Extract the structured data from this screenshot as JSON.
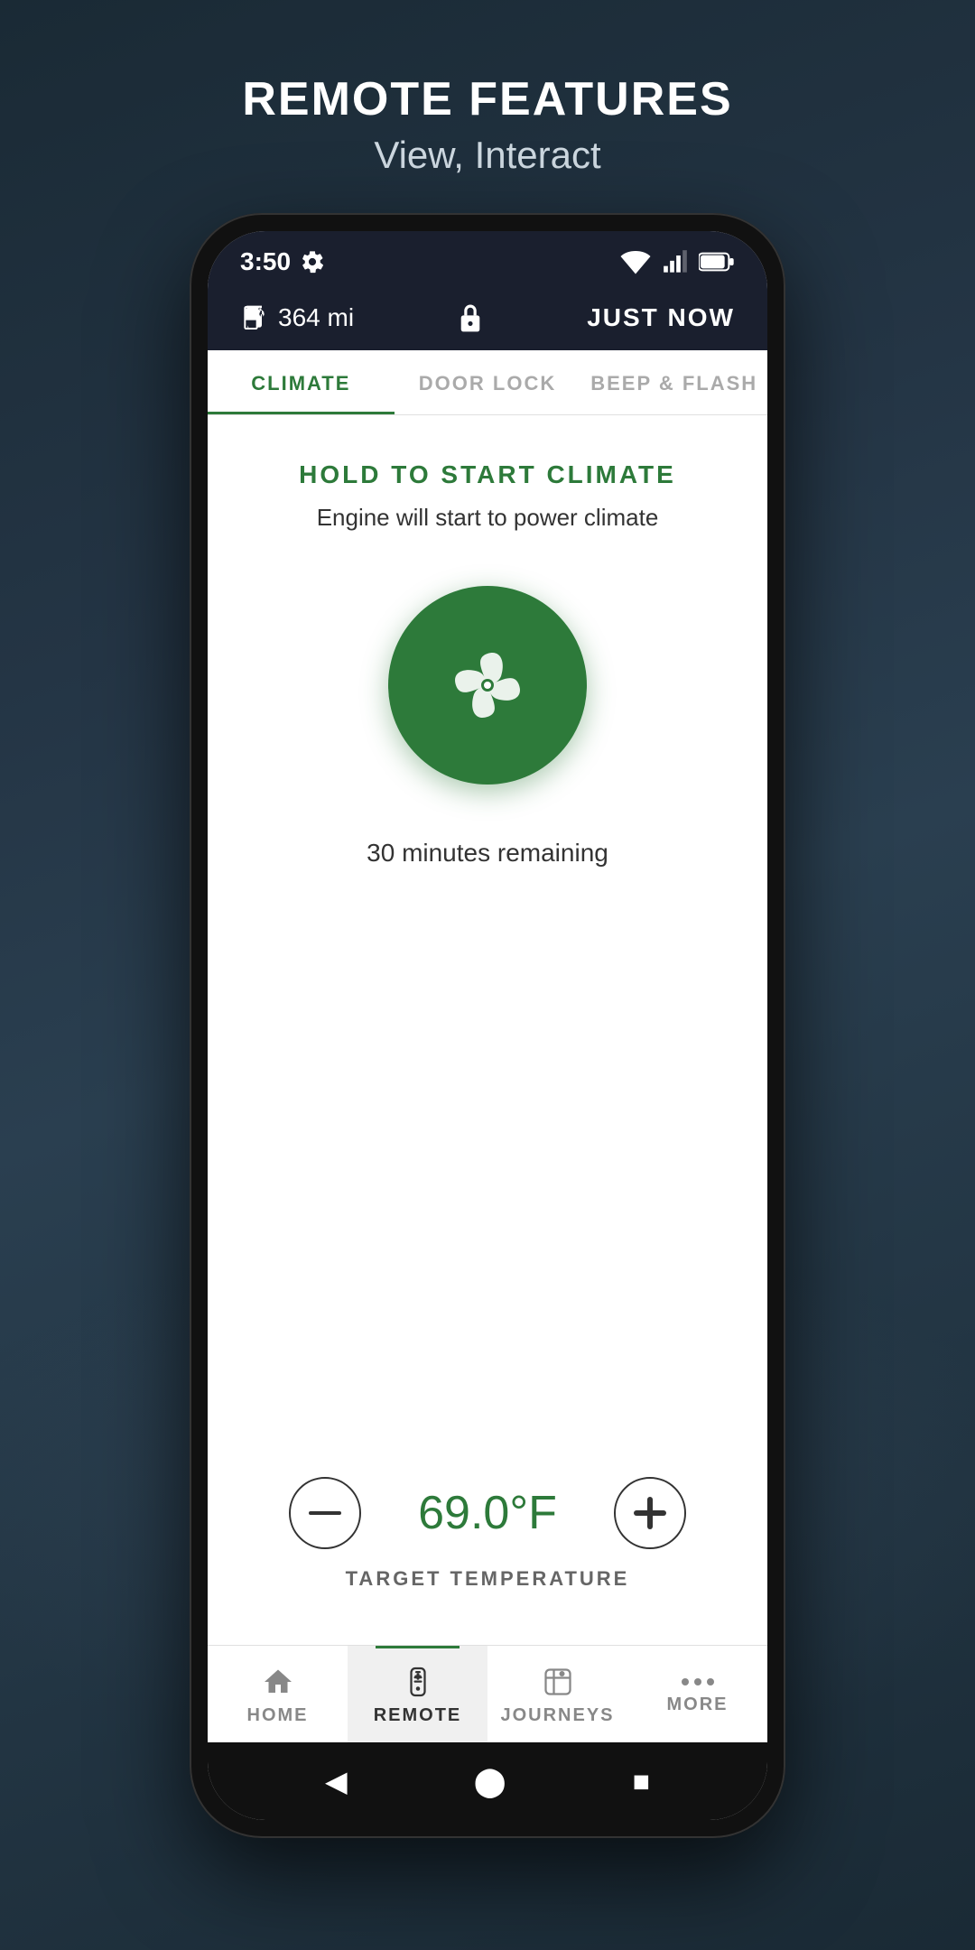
{
  "page": {
    "title": "REMOTE FEATURES",
    "subtitle": "View, Interact"
  },
  "statusBar": {
    "time": "3:50",
    "mileage": "364 mi",
    "syncStatus": "JUST NOW"
  },
  "tabs": [
    {
      "id": "climate",
      "label": "CLIMATE",
      "active": true
    },
    {
      "id": "doorlock",
      "label": "DOOR LOCK",
      "active": false
    },
    {
      "id": "beepflash",
      "label": "BEEP & FLASH",
      "active": false
    }
  ],
  "climate": {
    "holdTitle": "HOLD TO START CLIMATE",
    "engineSubtitle": "Engine will start to power climate",
    "minutesRemaining": "30 minutes remaining",
    "temperature": "69.0°F",
    "targetLabel": "TARGET TEMPERATURE"
  },
  "bottomNav": [
    {
      "id": "home",
      "label": "HOME",
      "active": false,
      "icon": "home"
    },
    {
      "id": "remote",
      "label": "REMOTE",
      "active": true,
      "icon": "remote"
    },
    {
      "id": "journeys",
      "label": "JOURNEYS",
      "active": false,
      "icon": "journeys"
    },
    {
      "id": "more",
      "label": "MORE",
      "active": false,
      "icon": "more"
    }
  ],
  "colors": {
    "green": "#2d7a3a",
    "darkBg": "#1a1f2e",
    "white": "#ffffff"
  }
}
